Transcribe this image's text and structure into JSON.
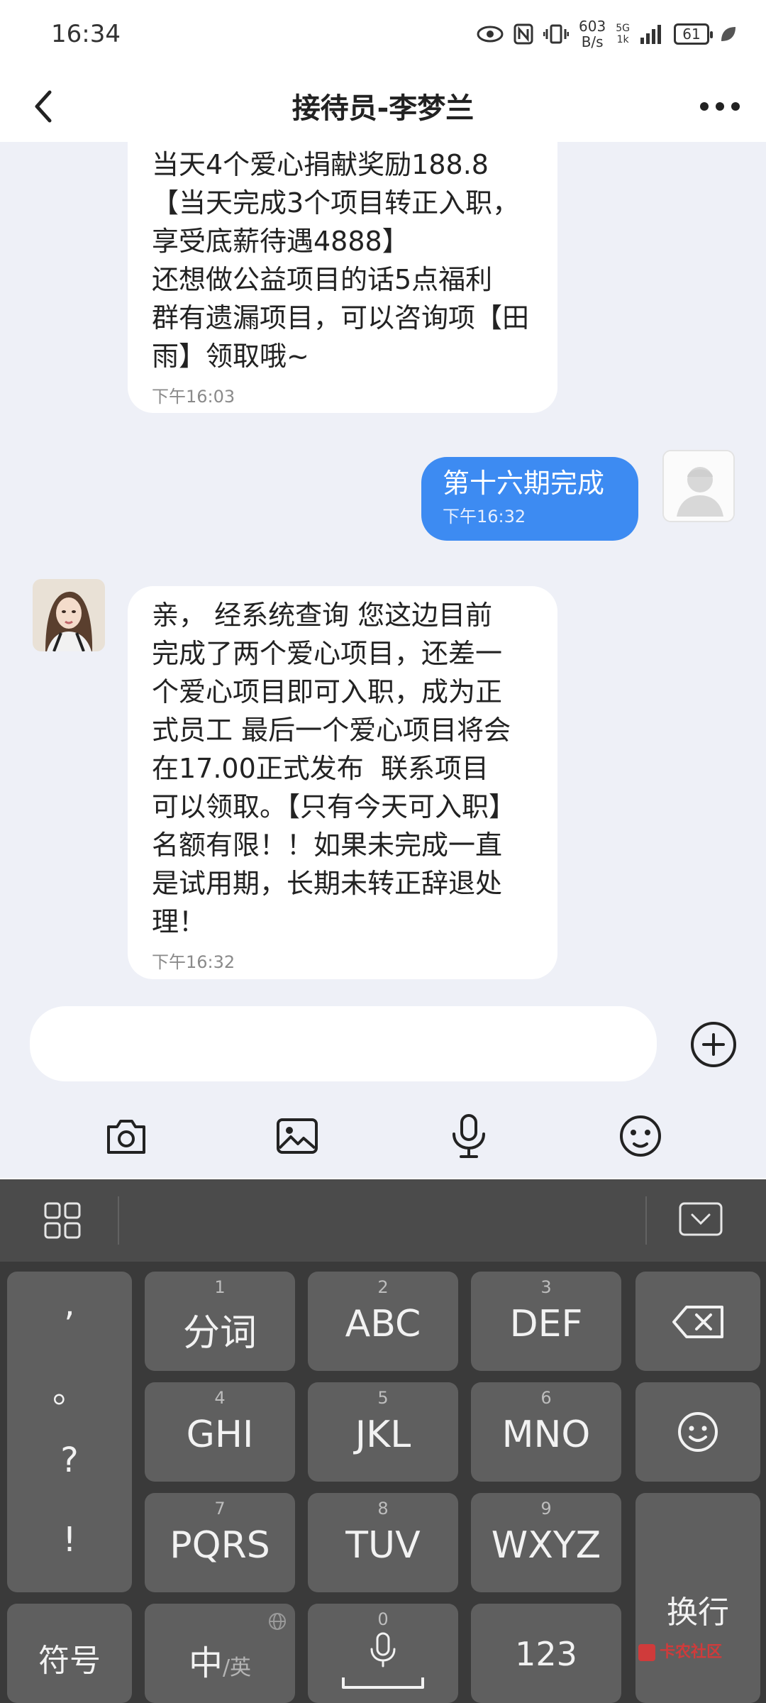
{
  "status_bar": {
    "time": "16:34",
    "speed_value": "603",
    "speed_unit": "B/s",
    "network_top": "5G",
    "network_bottom": "1k",
    "battery": "61"
  },
  "header": {
    "title": "接待员-李梦兰"
  },
  "messages": [
    {
      "side": "in",
      "text": "当天4个爱心捐献奖励188.8\n【当天完成3个项目转正入职，\n享受底薪待遇4888】\n还想做公益项目的话5点福利\n群有遗漏项目，可以咨询项【田\n雨】领取哦~",
      "time": "下午16:03"
    },
    {
      "side": "out",
      "text": "第十六期完成",
      "time": "下午16:32"
    },
    {
      "side": "in",
      "text": "亲， 经系统查询 您这边目前\n完成了两个爱心项目，还差一\n个爱心项目即可入职，成为正\n式员工 最后一个爱心项目将会\n在17.00正式发布  联系项目\n可以领取。【只有今天可入职】\n名额有限！！如果未完成一直\n是试用期，长期未转正辞退处\n理！",
      "time": "下午16:32"
    }
  ],
  "input": {
    "placeholder": ""
  },
  "toolbar_icons": [
    "camera-icon",
    "image-icon",
    "microphone-icon",
    "emoji-icon"
  ],
  "keyboard": {
    "punct": [
      ",",
      "。",
      "?",
      "!"
    ],
    "keys": [
      {
        "num": "1",
        "label": "分词"
      },
      {
        "num": "2",
        "label": "ABC"
      },
      {
        "num": "3",
        "label": "DEF"
      },
      {
        "num": "4",
        "label": "GHI"
      },
      {
        "num": "5",
        "label": "JKL"
      },
      {
        "num": "6",
        "label": "MNO"
      },
      {
        "num": "7",
        "label": "PQRS"
      },
      {
        "num": "8",
        "label": "TUV"
      },
      {
        "num": "9",
        "label": "WXYZ"
      }
    ],
    "symbols": "符号",
    "lang_main": "中",
    "lang_alt": "/英",
    "space_num": "0",
    "num_key": "123",
    "enter": "换行"
  },
  "watermark": "卡农社区"
}
